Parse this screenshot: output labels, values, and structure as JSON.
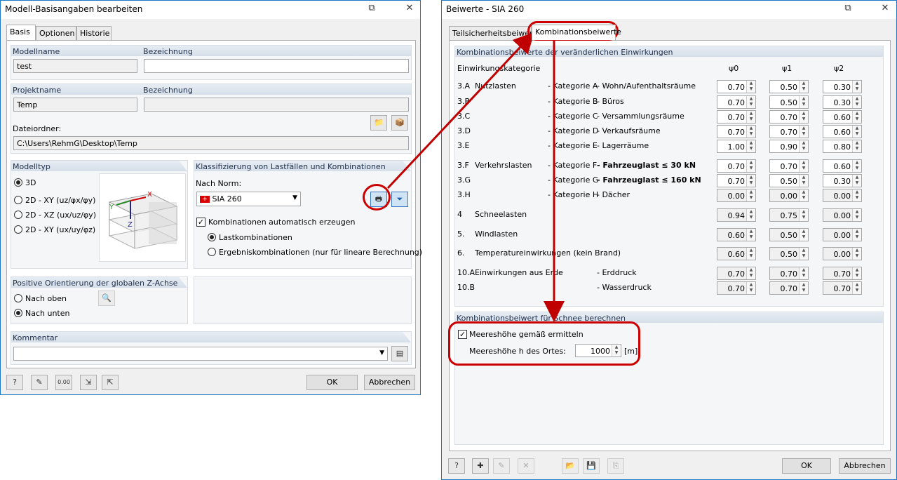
{
  "left": {
    "title": "Modell-Basisangaben bearbeiten",
    "tabs": [
      "Basis",
      "Optionen",
      "Historie"
    ],
    "modellname_label": "Modellname",
    "modellname_value": "test",
    "bezeichnung_label": "Bezeichnung",
    "projektname_label": "Projektname",
    "projektname_value": "Temp",
    "dateiordner_label": "Dateiordner:",
    "dateiordner_value": "C:\\Users\\RehmG\\Desktop\\Temp",
    "modelltyp_label": "Modelltyp",
    "modelltyp_options": [
      "3D",
      "2D - XY (uz/φx/φy)",
      "2D - XZ (ux/uz/φy)",
      "2D - XY (ux/uy/φz)"
    ],
    "klass_label": "Klassifizierung von Lastfällen und Kombinationen",
    "norm_label": "Nach Norm:",
    "norm_value": "SIA 260",
    "auto_label": "Kombinationen automatisch erzeugen",
    "lastkomb_label": "Lastkombinationen",
    "ergkomb_label": "Ergebniskombinationen (nur für lineare Berechnung)",
    "orient_label": "Positive Orientierung der globalen Z-Achse",
    "nach_oben": "Nach oben",
    "nach_unten": "Nach unten",
    "kommentar_label": "Kommentar",
    "ok": "OK",
    "abbrechen": "Abbrechen",
    "axes": {
      "y": "Y",
      "x": "X",
      "z": "Z"
    }
  },
  "right": {
    "title": "Beiwerte - SIA 260",
    "tabs": [
      "Teilsicherheitsbeiwerte",
      "Kombinationsbeiwerte"
    ],
    "group1": "Kombinationsbeiwerte der veränderlichen Einwirkungen",
    "col_kat": "Einwirkungskategorie",
    "col_psi": [
      "ψ0",
      "ψ1",
      "ψ2"
    ],
    "rows": [
      {
        "code": "3.A",
        "name": "Nutzlasten",
        "kat": "- Kategorie A",
        "desc": "- Wohn/Aufenthaltsräume",
        "p": [
          "0.70",
          "0.50",
          "0.30"
        ],
        "bold": false,
        "ro": false
      },
      {
        "code": "3.B",
        "name": "",
        "kat": "- Kategorie B",
        "desc": "- Büros",
        "p": [
          "0.70",
          "0.50",
          "0.30"
        ],
        "bold": false,
        "ro": false
      },
      {
        "code": "3.C",
        "name": "",
        "kat": "- Kategorie C",
        "desc": "- Versammlungsräume",
        "p": [
          "0.70",
          "0.70",
          "0.60"
        ],
        "bold": false,
        "ro": false
      },
      {
        "code": "3.D",
        "name": "",
        "kat": "- Kategorie D",
        "desc": "- Verkaufsräume",
        "p": [
          "0.70",
          "0.70",
          "0.60"
        ],
        "bold": false,
        "ro": false
      },
      {
        "code": "3.E",
        "name": "",
        "kat": "- Kategorie E",
        "desc": "- Lagerräume",
        "p": [
          "1.00",
          "0.90",
          "0.80"
        ],
        "bold": false,
        "ro": false
      },
      {
        "code": "3.F",
        "name": "Verkehrslasten",
        "kat": "- Kategorie F",
        "desc": "- Fahrzeuglast ≤ 30 kN",
        "p": [
          "0.70",
          "0.70",
          "0.60"
        ],
        "bold": true,
        "ro": false
      },
      {
        "code": "3.G",
        "name": "",
        "kat": "- Kategorie G",
        "desc": "- Fahrzeuglast ≤ 160 kN",
        "p": [
          "0.70",
          "0.50",
          "0.30"
        ],
        "bold": true,
        "ro": false
      },
      {
        "code": "3.H",
        "name": "",
        "kat": "- Kategorie H",
        "desc": "- Dächer",
        "p": [
          "0.00",
          "0.00",
          "0.00"
        ],
        "bold": false,
        "ro": true
      },
      {
        "code": "4",
        "name": "Schneelasten",
        "kat": "",
        "desc": "",
        "p": [
          "0.94",
          "0.75",
          "0.00"
        ],
        "bold": false,
        "ro": true
      },
      {
        "code": "5.",
        "name": "Windlasten",
        "kat": "",
        "desc": "",
        "p": [
          "0.60",
          "0.50",
          "0.00"
        ],
        "bold": false,
        "ro": true
      },
      {
        "code": "6.",
        "name": "Temperatureinwirkungen (kein Brand)",
        "kat": "",
        "desc": "",
        "p": [
          "0.60",
          "0.50",
          "0.00"
        ],
        "bold": false,
        "ro": true
      },
      {
        "code": "10.A",
        "name": "Einwirkungen aus Erde",
        "kat": "",
        "desc": "- Erddruck",
        "p": [
          "0.70",
          "0.70",
          "0.70"
        ],
        "bold": false,
        "ro": true
      },
      {
        "code": "10.B",
        "name": "",
        "kat": "",
        "desc": "- Wasserdruck",
        "p": [
          "0.70",
          "0.70",
          "0.70"
        ],
        "bold": false,
        "ro": true
      }
    ],
    "group2": "Kombinationsbeiwert für Schnee berechnen",
    "meer_chk": "Meereshöhe gemäß ermitteln",
    "meer_label": "Meereshöhe h des Ortes:",
    "meer_value": "1000",
    "meer_unit": "[m]",
    "ok": "OK",
    "abbrechen": "Abbrechen"
  },
  "colors": {
    "annotation": "#c00000",
    "title_border": "#1c78c4"
  }
}
